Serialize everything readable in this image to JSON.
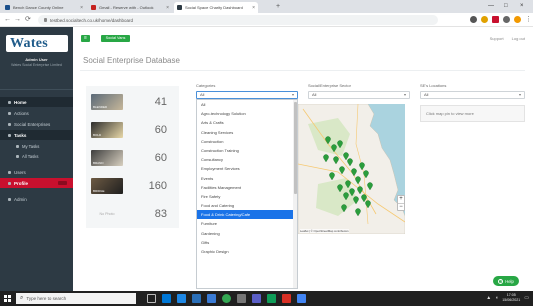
{
  "browser": {
    "tabs": [
      {
        "title": "Bench Dance County Online",
        "color": "#1a4f8b",
        "active": false
      },
      {
        "title": "Gmail - Reserve with - Outlook",
        "color": "#c5221f",
        "active": false
      },
      {
        "title": "Social Space Charity Dashboard",
        "color": "#2d3a44",
        "active": true
      }
    ],
    "new_tab": "+",
    "window_controls": [
      "—",
      "□",
      "×"
    ],
    "url": "testbed.socialtech.co.uk/home/dashboard",
    "extension_colors": [
      "#555555",
      "#e0a100",
      "#c8102e",
      "#666666",
      "#f29900"
    ]
  },
  "sidebar": {
    "brand": "Wates",
    "user_name": "Admin User",
    "user_role": "Wates Social Enterprise Limited",
    "items": [
      {
        "label": "Home",
        "type": "active"
      },
      {
        "label": "Actions",
        "type": "normal"
      },
      {
        "label": "Social Enterprises",
        "type": "normal"
      },
      {
        "label": "Tasks",
        "type": "active"
      },
      {
        "label": "My Tasks",
        "type": "sub"
      },
      {
        "label": "All Tasks",
        "type": "sub"
      },
      {
        "label": "Users",
        "type": "normal"
      },
      {
        "label": "Profile",
        "type": "highlight"
      },
      {
        "label": "Admin",
        "type": "normal"
      }
    ]
  },
  "topbar": {
    "menu_icon": "≡",
    "action_label": "Social Vans",
    "links": [
      "Support",
      "Log out"
    ]
  },
  "page": {
    "title": "Social Enterprise Database"
  },
  "stats": [
    {
      "thumb_label": "BLENDED",
      "value": "41",
      "colors": [
        "#5b6a78",
        "#c6b79a"
      ]
    },
    {
      "thumb_label": "BOLD",
      "value": "60",
      "colors": [
        "#2c2c2c",
        "#e8d8a8"
      ]
    },
    {
      "thumb_label": "BRAND",
      "value": "60",
      "colors": [
        "#3d3d3d",
        "#d8d0c0"
      ]
    },
    {
      "thumb_label": "BRIDGE",
      "value": "160",
      "colors": [
        "#6d5a43",
        "#1f1f1f"
      ]
    },
    {
      "thumb_label": "No Photo",
      "value": "83",
      "colors": []
    }
  ],
  "filters": {
    "categories_label": "Categories",
    "categories_value": "All",
    "social_label": "Social/Enterprise Sector",
    "social_value": "All",
    "location_label": "SE's Locations",
    "location_value": "All",
    "hint": "Click map pin to view more"
  },
  "categories_options": [
    {
      "label": "All",
      "selected": false
    },
    {
      "label": "Agro-technology Solution",
      "selected": false
    },
    {
      "label": "Arts & Crafts",
      "selected": false
    },
    {
      "label": "Cleaning Services",
      "selected": false
    },
    {
      "label": "Construction",
      "selected": false
    },
    {
      "label": "Construction Training",
      "selected": false
    },
    {
      "label": "Consultancy",
      "selected": false
    },
    {
      "label": "Employment Services",
      "selected": false
    },
    {
      "label": "Events",
      "selected": false
    },
    {
      "label": "Facilities Management",
      "selected": false
    },
    {
      "label": "Fire Safety",
      "selected": false
    },
    {
      "label": "Food and Catering",
      "selected": false
    },
    {
      "label": "Food & Drink Catering/Cafe",
      "selected": true
    },
    {
      "label": "Furniture",
      "selected": false
    },
    {
      "label": "Gardening",
      "selected": false
    },
    {
      "label": "Gifts",
      "selected": false
    },
    {
      "label": "Graphic Design",
      "selected": false
    }
  ],
  "map": {
    "land_color": "#f2efe9",
    "water_color": "#aad3df",
    "pin_color": "#2a9d3c",
    "zoom_in": "+",
    "zoom_out": "−",
    "attribution": "Leaflet | © OpenStreetMap contributors"
  },
  "help": {
    "label": "Help",
    "icon": "?"
  },
  "taskbar": {
    "search_placeholder": "Type here to search",
    "clock_time": "17:05",
    "clock_date": "15/06/2021"
  }
}
